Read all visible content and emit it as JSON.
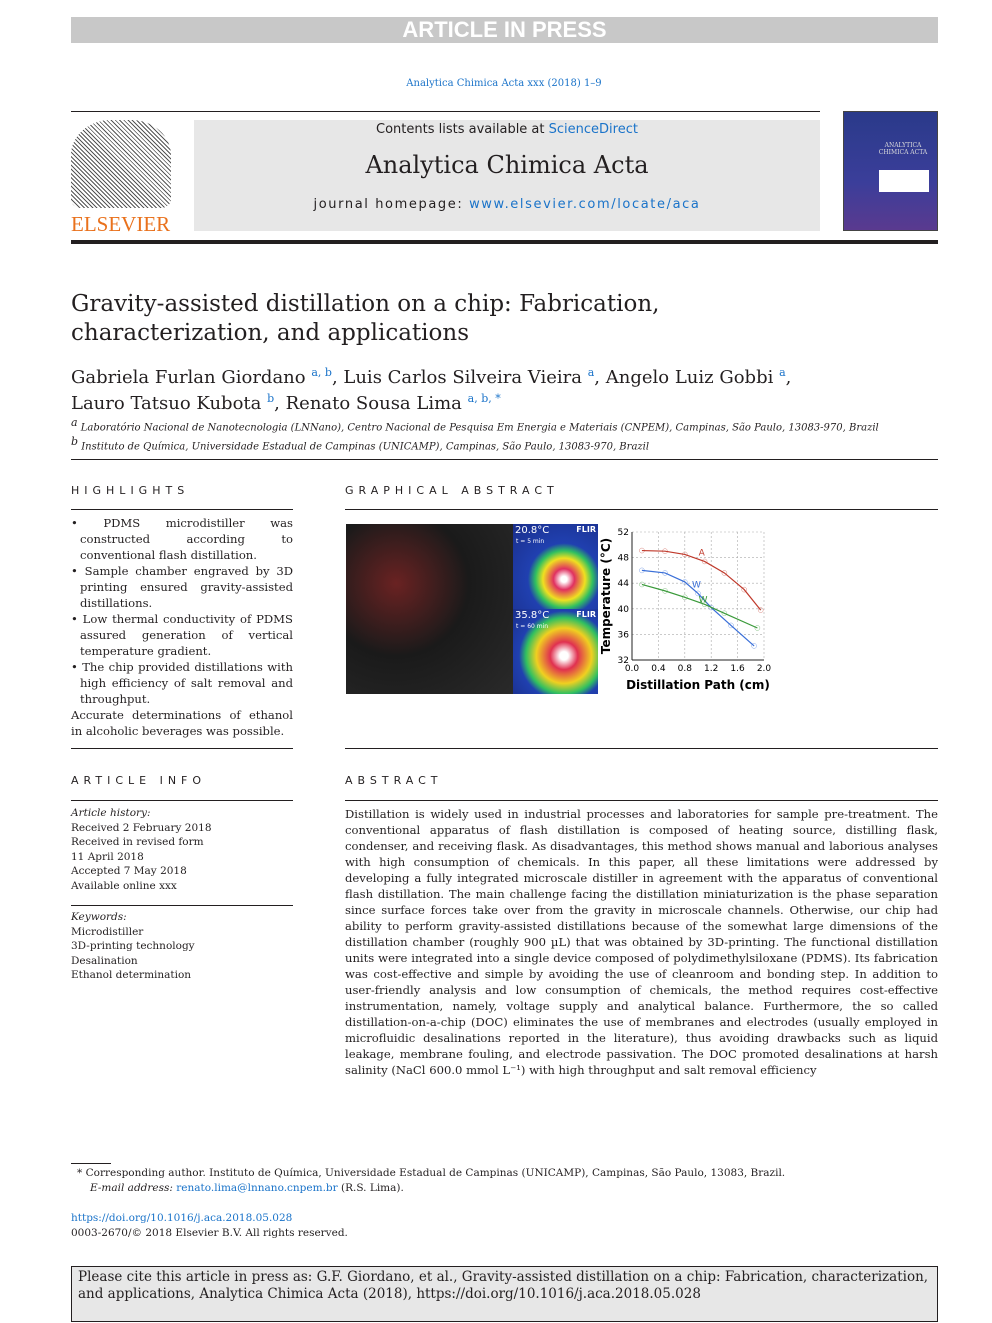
{
  "banner": "ARTICLE IN PRESS",
  "citation_line": "Analytica Chimica Acta xxx (2018) 1–9",
  "publisher_logo_text": "ELSEVIER",
  "journal": {
    "contents_prefix": "Contents lists available at ",
    "contents_link": "ScienceDirect",
    "title": "Analytica Chimica Acta",
    "homepage_prefix": "journal homepage: ",
    "homepage_link": "www.elsevier.com/locate/aca"
  },
  "cover_text": "ANALYTICA CHIMICA ACTA",
  "article": {
    "title": "Gravity-assisted distillation on a chip: Fabrication, characterization, and applications",
    "authors": [
      {
        "name": "Gabriela Furlan Giordano",
        "aff": "a, b",
        "sep": ", "
      },
      {
        "name": "Luis Carlos Silveira Vieira",
        "aff": "a",
        "sep": ", "
      },
      {
        "name": "Angelo Luiz Gobbi",
        "aff": "a",
        "sep": ","
      },
      {
        "name": "Lauro Tatsuo Kubota",
        "aff": "b",
        "sep": ", "
      },
      {
        "name": "Renato Sousa Lima",
        "aff": "a, b, *",
        "sep": ""
      }
    ],
    "affiliations": [
      {
        "mark": "a",
        "text": "Laboratório Nacional de Nanotecnologia (LNNano), Centro Nacional de Pesquisa Em Energia e Materiais (CNPEM), Campinas, São Paulo, 13083-970, Brazil"
      },
      {
        "mark": "b",
        "text": "Instituto de Química, Universidade Estadual de Campinas (UNICAMP), Campinas, São Paulo, 13083-970, Brazil"
      }
    ]
  },
  "highlights": {
    "heading": "HIGHLIGHTS",
    "items": [
      "PDMS microdistiller was constructed according to conventional flash distillation.",
      "Sample chamber engraved by 3D printing ensured gravity-assisted distillations.",
      "Low thermal conductivity of PDMS assured generation of vertical temperature gradient.",
      "The chip provided distillations with high efficiency of salt removal and throughput."
    ],
    "tail": "Accurate determinations of ethanol in alcoholic beverages was possible."
  },
  "graphical_abstract": {
    "heading": "GRAPHICAL ABSTRACT",
    "thermal1": {
      "temp": "20.8°C",
      "time": "t = 5 min",
      "brand": "FLIR"
    },
    "thermal2": {
      "temp": "35.8°C",
      "time": "t = 60 min",
      "brand": "FLIR"
    }
  },
  "chart_data": {
    "type": "line",
    "xlabel": "Distillation Path (cm)",
    "ylabel": "Temperature (°C)",
    "xlim": [
      0,
      2.0
    ],
    "ylim": [
      32,
      52
    ],
    "xticks": [
      "0.0",
      "0.4",
      "0.8",
      "1.2",
      "1.6",
      "2.0"
    ],
    "yticks": [
      "32",
      "36",
      "40",
      "44",
      "48",
      "52"
    ],
    "grid": true,
    "series": [
      {
        "label": "A",
        "color": "#c0392b",
        "x": [
          0.15,
          0.5,
          0.8,
          1.1,
          1.4,
          1.7,
          1.95
        ],
        "y": [
          49.1,
          49.0,
          48.5,
          47.4,
          45.6,
          43.0,
          39.8
        ]
      },
      {
        "label": "W",
        "color": "#3a6fd8",
        "x": [
          0.15,
          0.5,
          0.8,
          1.0,
          1.2,
          1.5,
          1.85
        ],
        "y": [
          46.0,
          45.6,
          44.2,
          42.4,
          40.2,
          37.4,
          34.2
        ]
      },
      {
        "label": "W",
        "color": "#3a9a3a",
        "x": [
          0.15,
          0.5,
          0.8,
          1.1,
          1.4,
          1.9
        ],
        "y": [
          43.8,
          42.8,
          41.8,
          40.7,
          39.3,
          37.0
        ]
      }
    ]
  },
  "article_info": {
    "heading": "ARTICLE INFO",
    "history_label": "Article history:",
    "history": [
      "Received 2 February 2018",
      "Received in revised form",
      "11 April 2018",
      "Accepted 7 May 2018",
      "Available online xxx"
    ],
    "keywords_label": "Keywords:",
    "keywords": [
      "Microdistiller",
      "3D-printing technology",
      "Desalination",
      "Ethanol determination"
    ]
  },
  "abstract": {
    "heading": "ABSTRACT",
    "text": "Distillation is widely used in industrial processes and laboratories for sample pre-treatment. The conventional apparatus of flash distillation is composed of heating source, distilling flask, condenser, and receiving flask. As disadvantages, this method shows manual and laborious analyses with high consumption of chemicals. In this paper, all these limitations were addressed by developing a fully integrated microscale distiller in agreement with the apparatus of conventional flash distillation. The main challenge facing the distillation miniaturization is the phase separation since surface forces take over from the gravity in microscale channels. Otherwise, our chip had ability to perform gravity-assisted distillations because of the somewhat large dimensions of the distillation chamber (roughly 900 µL) that was obtained by 3D-printing. The functional distillation units were integrated into a single device composed of polydimethylsiloxane (PDMS). Its fabrication was cost-effective and simple by avoiding the use of cleanroom and bonding step. In addition to user-friendly analysis and low consumption of chemicals, the method requires cost-effective instrumentation, namely, voltage supply and analytical balance. Furthermore, the so called distillation-on-a-chip (DOC) eliminates the use of membranes and electrodes (usually employed in microfluidic desalinations reported in the literature), thus avoiding drawbacks such as liquid leakage, membrane fouling, and electrode passivation. The DOC promoted desalinations at harsh salinity (NaCl 600.0 mmol L⁻¹) with high throughput and salt removal efficiency"
  },
  "footnote": {
    "mark": "*",
    "text": "Corresponding author. Instituto de Química, Universidade Estadual de Campinas (UNICAMP), Campinas, São Paulo, 13083, Brazil.",
    "email_label": "E-mail address: ",
    "email": "renato.lima@lnnano.cnpem.br",
    "email_tail": " (R.S. Lima)."
  },
  "doi": "https://doi.org/10.1016/j.aca.2018.05.028",
  "copyright": "0003-2670/© 2018 Elsevier B.V. All rights reserved.",
  "cite_box": "Please cite this article in press as: G.F. Giordano, et al., Gravity-assisted distillation on a chip: Fabrication, characterization, and applications, Analytica Chimica Acta (2018), https://doi.org/10.1016/j.aca.2018.05.028"
}
